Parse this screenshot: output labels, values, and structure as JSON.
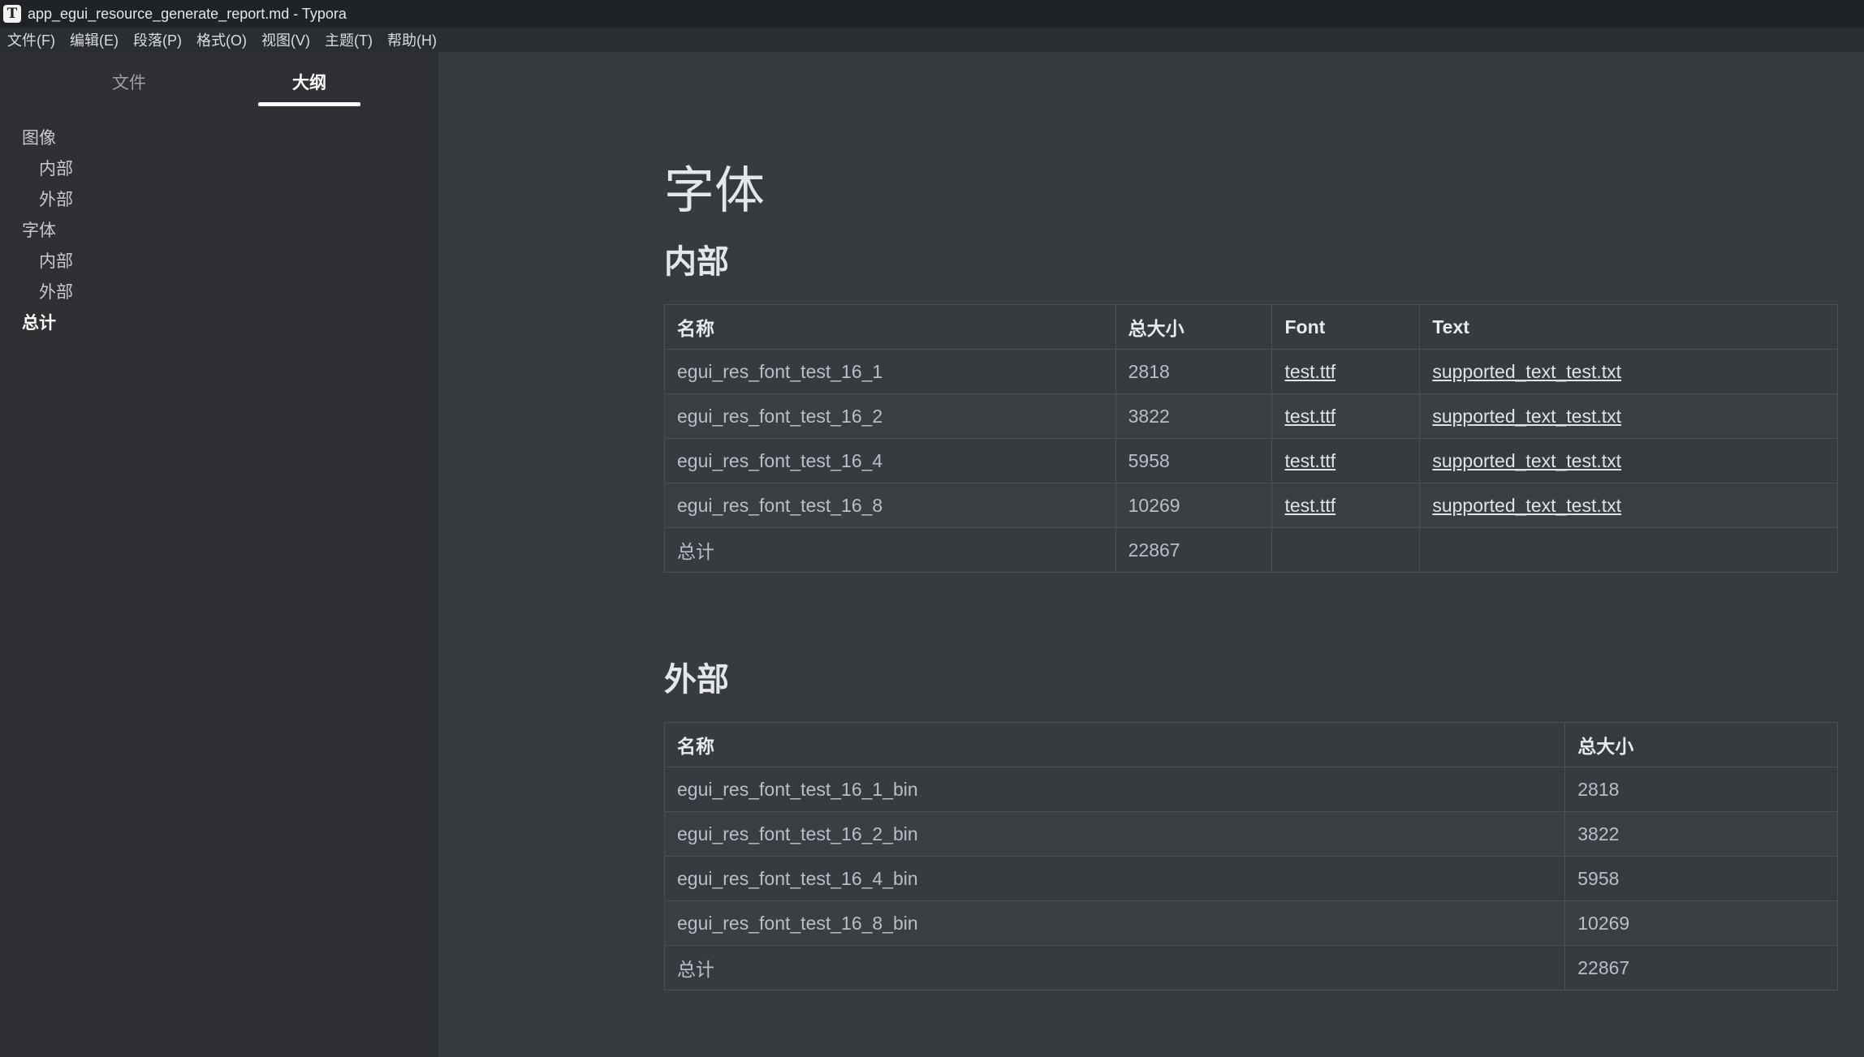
{
  "window": {
    "title": "app_egui_resource_generate_report.md - Typora",
    "app_icon_letter": "T"
  },
  "menu": [
    "文件(F)",
    "编辑(E)",
    "段落(P)",
    "格式(O)",
    "视图(V)",
    "主题(T)",
    "帮助(H)"
  ],
  "sidebar": {
    "tabs": {
      "files": "文件",
      "outline": "大纲",
      "active": "outline"
    },
    "outline": [
      {
        "label": "图像",
        "level": 1
      },
      {
        "label": "内部",
        "level": 2
      },
      {
        "label": "外部",
        "level": 2
      },
      {
        "label": "字体",
        "level": 1
      },
      {
        "label": "内部",
        "level": 2
      },
      {
        "label": "外部",
        "level": 2
      },
      {
        "label": "总计",
        "level": 1,
        "active": true
      }
    ]
  },
  "document": {
    "title": "字体",
    "internal": {
      "heading": "内部",
      "headers": [
        "名称",
        "总大小",
        "Font",
        "Text"
      ],
      "rows": [
        [
          "egui_res_font_test_16_1",
          "2818",
          "test.ttf",
          "supported_text_test.txt"
        ],
        [
          "egui_res_font_test_16_2",
          "3822",
          "test.ttf",
          "supported_text_test.txt"
        ],
        [
          "egui_res_font_test_16_4",
          "5958",
          "test.ttf",
          "supported_text_test.txt"
        ],
        [
          "egui_res_font_test_16_8",
          "10269",
          "test.ttf",
          "supported_text_test.txt"
        ],
        [
          "总计",
          "22867",
          "",
          ""
        ]
      ]
    },
    "external": {
      "heading": "外部",
      "headers": [
        "名称",
        "总大小"
      ],
      "rows": [
        [
          "egui_res_font_test_16_1_bin",
          "2818"
        ],
        [
          "egui_res_font_test_16_2_bin",
          "3822"
        ],
        [
          "egui_res_font_test_16_4_bin",
          "5958"
        ],
        [
          "egui_res_font_test_16_8_bin",
          "10269"
        ],
        [
          "总计",
          "22867"
        ]
      ]
    }
  },
  "colors": {
    "editor_bg": "#363b40",
    "sidebar_bg": "#2e3033",
    "titlebar_bg": "#1f2227",
    "menubar_bg": "#2a2d32"
  }
}
